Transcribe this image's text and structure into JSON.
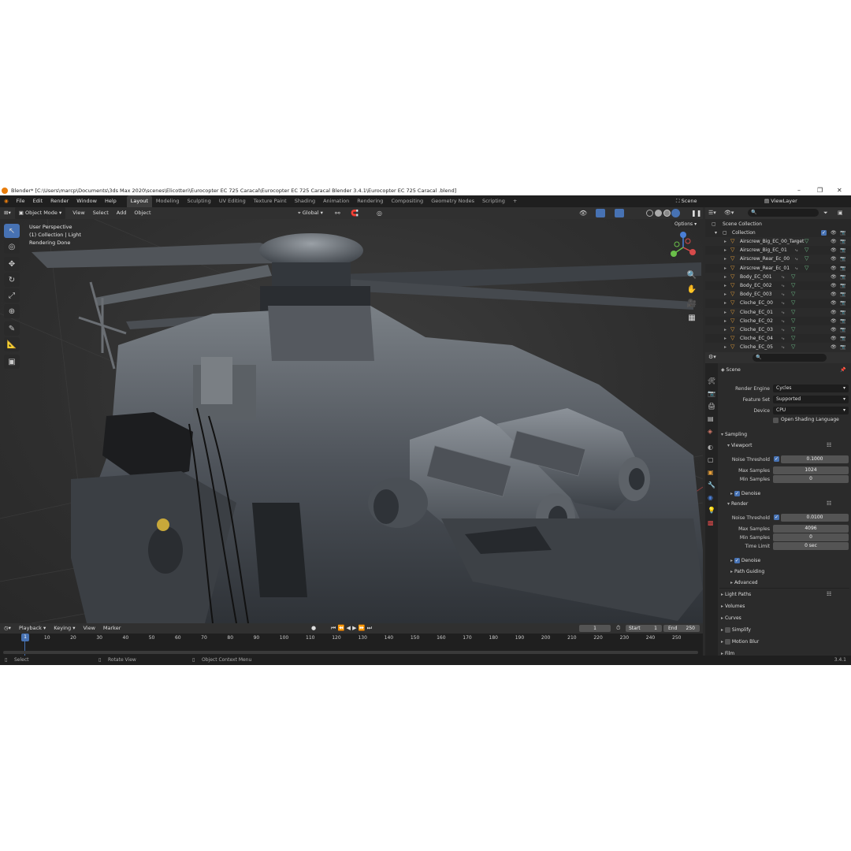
{
  "title": "Blender* [C:\\Users\\marcp\\Documents\\3ds Max 2020\\scenes\\Elicotteri\\Eurocopter EC 725 Caracal\\Eurocopter EC 725 Caracal Blender 3.4.1\\Eurocopter EC 725 Caracal .blend]",
  "menu": [
    "File",
    "Edit",
    "Render",
    "Window",
    "Help"
  ],
  "workspaces": [
    "Layout",
    "Modeling",
    "Sculpting",
    "UV Editing",
    "Texture Paint",
    "Shading",
    "Animation",
    "Rendering",
    "Compositing",
    "Geometry Nodes",
    "Scripting"
  ],
  "active_workspace": "Layout",
  "scene_name": "Scene",
  "view_layer": "ViewLayer",
  "viewport_header": {
    "mode": "Object Mode",
    "view": "View",
    "select": "Select",
    "add": "Add",
    "object": "Object",
    "orientation": "Global",
    "options": "Options"
  },
  "viewport_info": {
    "line1": "User Perspective",
    "line2": "(1) Collection | Light",
    "line3": "Rendering Done"
  },
  "outliner": {
    "root": "Scene Collection",
    "collection": "Collection",
    "items": [
      "Airscrew_Big_EC_00_Target",
      "Airscrew_Big_EC_01",
      "Airscrew_Rear_Ec_00",
      "Airscrew_Rear_Ec_01",
      "Body_EC_001",
      "Body_EC_002",
      "Body_EC_003",
      "Cloche_EC_00",
      "Cloche_EC_01",
      "Cloche_EC_02",
      "Cloche_EC_03",
      "Cloche_EC_04",
      "Cloche_EC_05"
    ]
  },
  "properties": {
    "context": "Scene",
    "render_engine_label": "Render Engine",
    "render_engine": "Cycles",
    "feature_set_label": "Feature Set",
    "feature_set": "Supported",
    "device_label": "Device",
    "device": "CPU",
    "osl_label": "Open Shading Language",
    "sampling": "Sampling",
    "viewport": "Viewport",
    "noise_threshold_label": "Noise Threshold",
    "vp_noise_threshold": "0.1000",
    "max_samples_label": "Max Samples",
    "vp_max_samples": "1024",
    "min_samples_label": "Min Samples",
    "vp_min_samples": "0",
    "denoise": "Denoise",
    "render": "Render",
    "r_noise_threshold": "0.0100",
    "r_max_samples": "4096",
    "r_min_samples": "0",
    "time_limit_label": "Time Limit",
    "r_time_limit": "0 sec",
    "path_guiding": "Path Guiding",
    "advanced": "Advanced",
    "light_paths": "Light Paths",
    "volumes": "Volumes",
    "curves": "Curves",
    "simplify": "Simplify",
    "motion_blur": "Motion Blur",
    "film": "Film"
  },
  "timeline": {
    "playback": "Playback",
    "keying": "Keying",
    "view": "View",
    "marker": "Marker",
    "current_frame": "1",
    "start_label": "Start",
    "start": "1",
    "end_label": "End",
    "end": "250",
    "ticks": [
      "1",
      "10",
      "20",
      "30",
      "40",
      "50",
      "60",
      "70",
      "80",
      "90",
      "100",
      "110",
      "120",
      "130",
      "140",
      "150",
      "160",
      "170",
      "180",
      "190",
      "200",
      "210",
      "220",
      "230",
      "240",
      "250"
    ]
  },
  "status": {
    "select": "Select",
    "rotate": "Rotate View",
    "context_menu": "Object Context Menu",
    "version": "3.4.1"
  },
  "colors": {
    "accent": "#4772b3",
    "object_orange": "#e8a03a",
    "mesh_green": "#6fc08a"
  }
}
